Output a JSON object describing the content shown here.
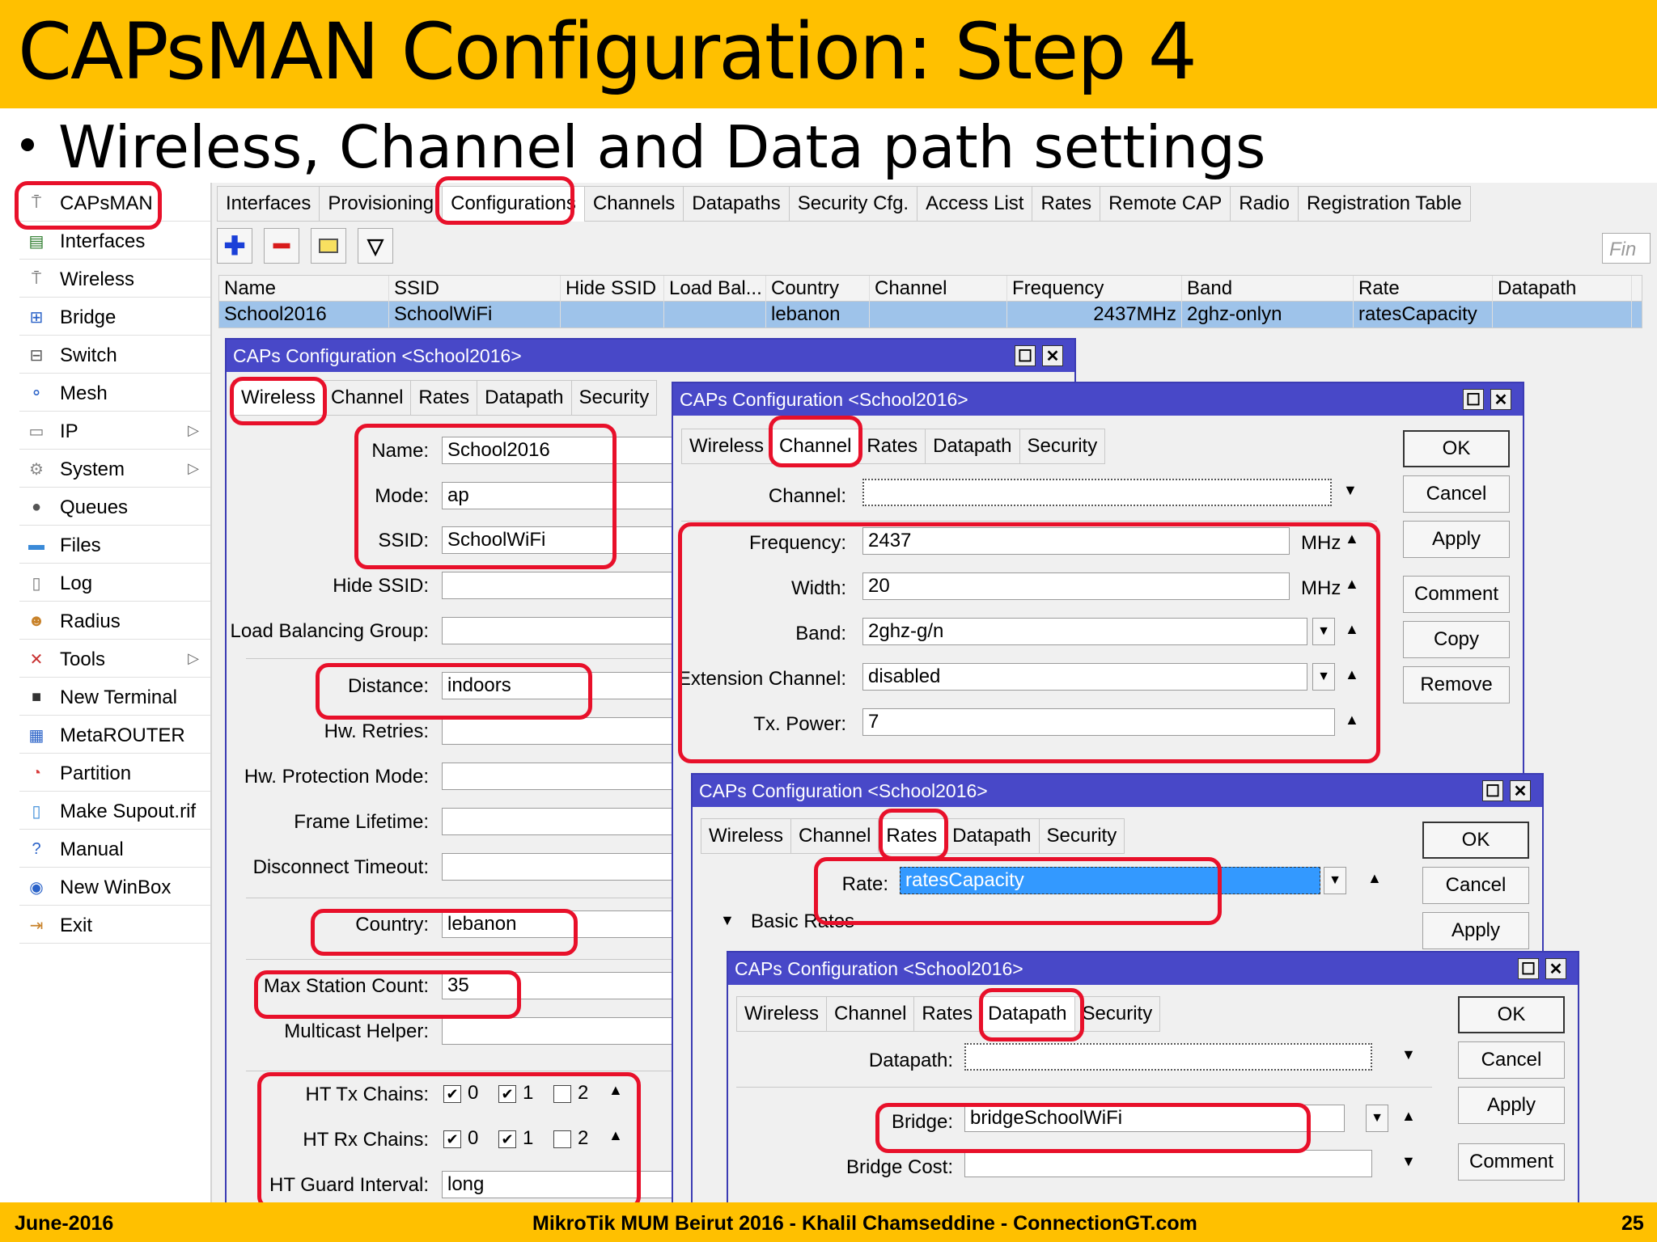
{
  "slide": {
    "title": "CAPsMAN Configuration: Step 4",
    "bullet": "Wireless, Channel and Data path settings",
    "footer_left": "June-2016",
    "footer_center": "MikroTik MUM Beirut 2016 - Khalil Chamseddine - ConnectionGT.com",
    "footer_right": "25"
  },
  "sidebar": {
    "items": [
      {
        "label": "CAPsMAN",
        "icon": "antenna-icon"
      },
      {
        "label": "Interfaces",
        "icon": "interfaces-icon"
      },
      {
        "label": "Wireless",
        "icon": "antenna-icon"
      },
      {
        "label": "Bridge",
        "icon": "bridge-icon"
      },
      {
        "label": "Switch",
        "icon": "switch-icon"
      },
      {
        "label": "Mesh",
        "icon": "mesh-icon"
      },
      {
        "label": "IP",
        "icon": "ip-icon"
      },
      {
        "label": "System",
        "icon": "gear-icon"
      },
      {
        "label": "Queues",
        "icon": "queues-icon"
      },
      {
        "label": "Files",
        "icon": "folder-icon"
      },
      {
        "label": "Log",
        "icon": "log-icon"
      },
      {
        "label": "Radius",
        "icon": "users-icon"
      },
      {
        "label": "Tools",
        "icon": "tools-icon"
      },
      {
        "label": "New Terminal",
        "icon": "terminal-icon"
      },
      {
        "label": "MetaROUTER",
        "icon": "metarouter-icon"
      },
      {
        "label": "Partition",
        "icon": "pie-icon"
      },
      {
        "label": "Make Supout.rif",
        "icon": "file-icon"
      },
      {
        "label": "Manual",
        "icon": "help-icon"
      },
      {
        "label": "New WinBox",
        "icon": "globe-icon"
      },
      {
        "label": "Exit",
        "icon": "exit-icon"
      }
    ]
  },
  "top_tabs": [
    "Interfaces",
    "Provisioning",
    "Configurations",
    "Channels",
    "Datapaths",
    "Security Cfg.",
    "Access List",
    "Rates",
    "Remote CAP",
    "Radio",
    "Registration Table"
  ],
  "find_placeholder": "Fin",
  "table": {
    "headers": [
      "Name",
      "SSID",
      "Hide SSID",
      "Load Bal...",
      "Country",
      "Channel",
      "Frequency",
      "Band",
      "Rate",
      "Datapath"
    ],
    "row": [
      "School2016",
      "SchoolWiFi",
      "",
      "",
      "lebanon",
      "",
      "2437MHz",
      "2ghz-onlyn",
      "ratesCapacity",
      ""
    ]
  },
  "win1": {
    "title": "CAPs Configuration <School2016>",
    "tabs": [
      "Wireless",
      "Channel",
      "Rates",
      "Datapath",
      "Security"
    ],
    "labels": {
      "name": "Name:",
      "mode": "Mode:",
      "ssid": "SSID:",
      "hide_ssid": "Hide SSID:",
      "lbg": "Load Balancing Group:",
      "distance": "Distance:",
      "hw_retries": "Hw. Retries:",
      "hw_prot": "Hw. Protection Mode:",
      "frame": "Frame Lifetime:",
      "disc": "Disconnect Timeout:",
      "country": "Country:",
      "max_station": "Max Station Count:",
      "multicast": "Multicast Helper:",
      "ht_tx": "HT Tx Chains:",
      "ht_rx": "HT Rx Chains:",
      "ht_guard": "HT Guard Interval:"
    },
    "values": {
      "name": "School2016",
      "mode": "ap",
      "ssid": "SchoolWiFi",
      "distance": "indoors",
      "country": "lebanon",
      "max_station": "35",
      "ht_guard": "long"
    },
    "chains": {
      "c0": "0",
      "c1": "1",
      "c2": "2"
    }
  },
  "win2": {
    "title": "CAPs Configuration <School2016>",
    "tabs": [
      "Wireless",
      "Channel",
      "Rates",
      "Datapath",
      "Security"
    ],
    "labels": {
      "channel": "Channel:",
      "frequency": "Frequency:",
      "width": "Width:",
      "band": "Band:",
      "ext": "Extension Channel:",
      "txpower": "Tx. Power:"
    },
    "values": {
      "channel": "",
      "frequency": "2437",
      "width": "20",
      "band": "2ghz-g/n",
      "ext": "disabled",
      "txpower": "7"
    },
    "unit": "MHz",
    "buttons": [
      "OK",
      "Cancel",
      "Apply",
      "Comment",
      "Copy",
      "Remove"
    ]
  },
  "win3": {
    "title": "CAPs Configuration <School2016>",
    "tabs": [
      "Wireless",
      "Channel",
      "Rates",
      "Datapath",
      "Security"
    ],
    "labels": {
      "rate": "Rate:",
      "basic": "Basic Rates"
    },
    "values": {
      "rate": "ratesCapacity"
    },
    "buttons": [
      "OK",
      "Cancel",
      "Apply"
    ]
  },
  "win4": {
    "title": "CAPs Configuration <School2016>",
    "tabs": [
      "Wireless",
      "Channel",
      "Rates",
      "Datapath",
      "Security"
    ],
    "labels": {
      "datapath": "Datapath:",
      "bridge": "Bridge:",
      "bridge_cost": "Bridge Cost:"
    },
    "values": {
      "datapath": "",
      "bridge": "bridgeSchoolWiFi",
      "bridge_cost": ""
    },
    "buttons": [
      "OK",
      "Cancel",
      "Apply",
      "Comment"
    ]
  },
  "colors": {
    "slide_bar": "#ffc000",
    "highlight": "#e8102a",
    "window_title": "#4848c8",
    "selection": "#9ec3ea"
  }
}
